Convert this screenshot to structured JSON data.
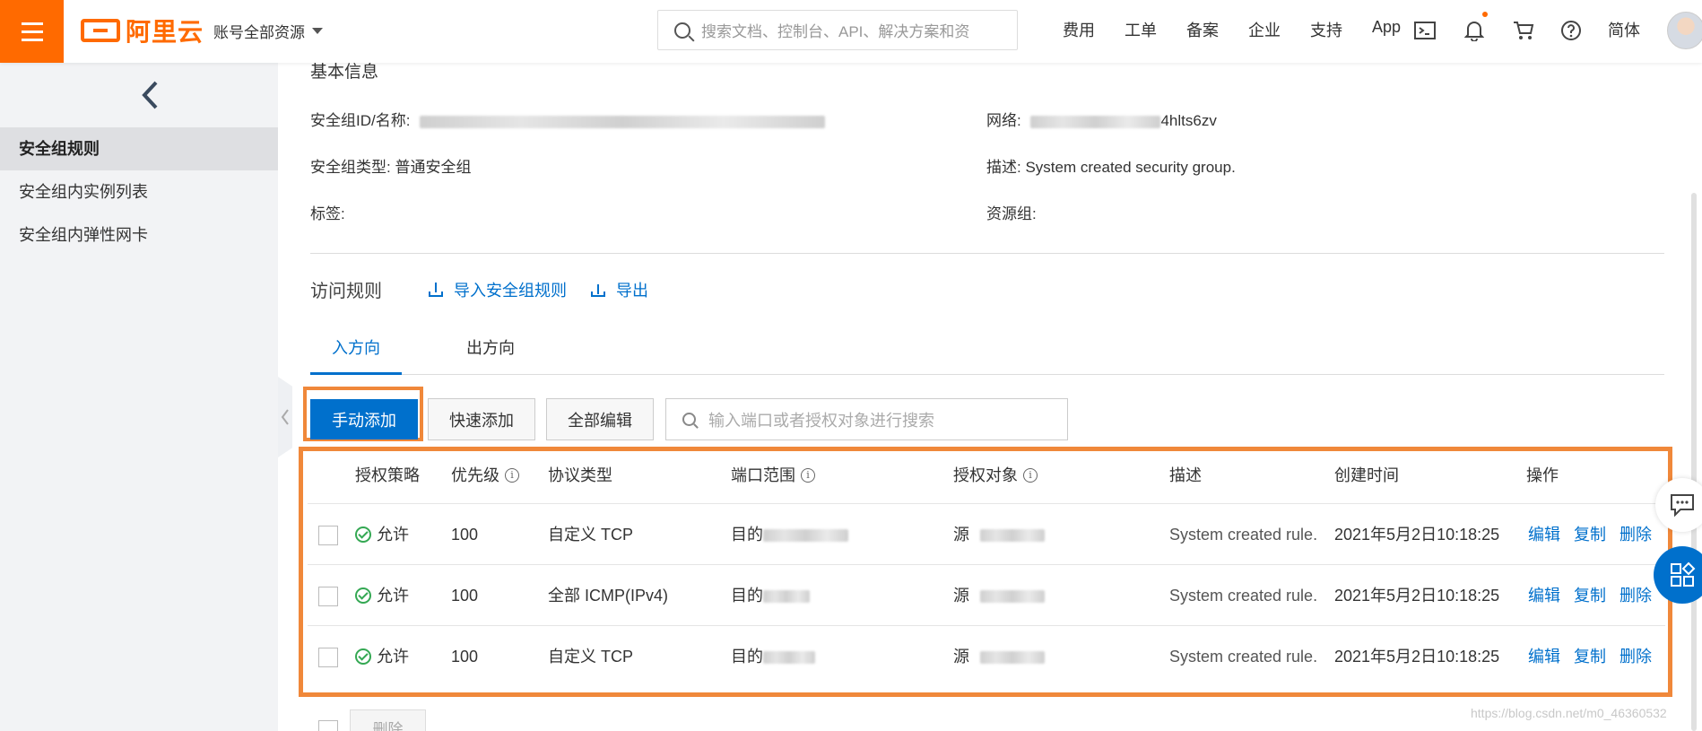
{
  "header": {
    "logo_text": "阿里云",
    "account_selector": "账号全部资源",
    "search_placeholder": "搜索文档、控制台、API、解决方案和资",
    "nav": [
      "费用",
      "工单",
      "备案",
      "企业",
      "支持",
      "App"
    ],
    "lang": "简体",
    "icons": [
      "terminal-icon",
      "bell-icon",
      "cart-icon",
      "help-icon"
    ]
  },
  "sidebar": {
    "items": [
      {
        "label": "安全组规则",
        "active": true
      },
      {
        "label": "安全组内实例列表",
        "active": false
      },
      {
        "label": "安全组内弹性网卡",
        "active": false
      }
    ]
  },
  "basic_info": {
    "title": "基本信息",
    "id_label": "安全组ID/名称:",
    "network_label": "网络:",
    "network_value_visible": "4hlts6zv",
    "type_label": "安全组类型:",
    "type_value": "普通安全组",
    "desc_label": "描述:",
    "desc_value": "System created security group.",
    "tag_label": "标签:",
    "resource_group_label": "资源组:"
  },
  "access_rules": {
    "title": "访问规则",
    "import_label": "导入安全组规则",
    "export_label": "导出",
    "tabs": [
      {
        "label": "入方向",
        "active": true
      },
      {
        "label": "出方向",
        "active": false
      }
    ],
    "buttons": {
      "manual_add": "手动添加",
      "quick_add": "快速添加",
      "edit_all": "全部编辑"
    },
    "search_placeholder": "输入端口或者授权对象进行搜索",
    "columns": [
      "授权策略",
      "优先级",
      "协议类型",
      "端口范围",
      "授权对象",
      "描述",
      "创建时间",
      "操作"
    ],
    "rows": [
      {
        "policy": "允许",
        "priority": "100",
        "protocol": "自定义 TCP",
        "port_prefix": "目的",
        "target_prefix": "源",
        "desc": "System created rule.",
        "created": "2021年5月2日10:18:25"
      },
      {
        "policy": "允许",
        "priority": "100",
        "protocol": "全部 ICMP(IPv4)",
        "port_prefix": "目的",
        "target_prefix": "源",
        "desc": "System created rule.",
        "created": "2021年5月2日10:18:25"
      },
      {
        "policy": "允许",
        "priority": "100",
        "protocol": "自定义 TCP",
        "port_prefix": "目的",
        "target_prefix": "源",
        "desc": "System created rule.",
        "created": "2021年5月2日10:18:25"
      }
    ],
    "actions": [
      "编辑",
      "复制",
      "删除"
    ],
    "bulk_delete": "删除"
  },
  "watermark": "https://blog.csdn.net/m0_46360532",
  "colors": {
    "brand_orange": "#ff6a00",
    "primary_blue": "#0070cc",
    "highlight_orange": "#f0883a",
    "allow_green": "#34a853"
  }
}
